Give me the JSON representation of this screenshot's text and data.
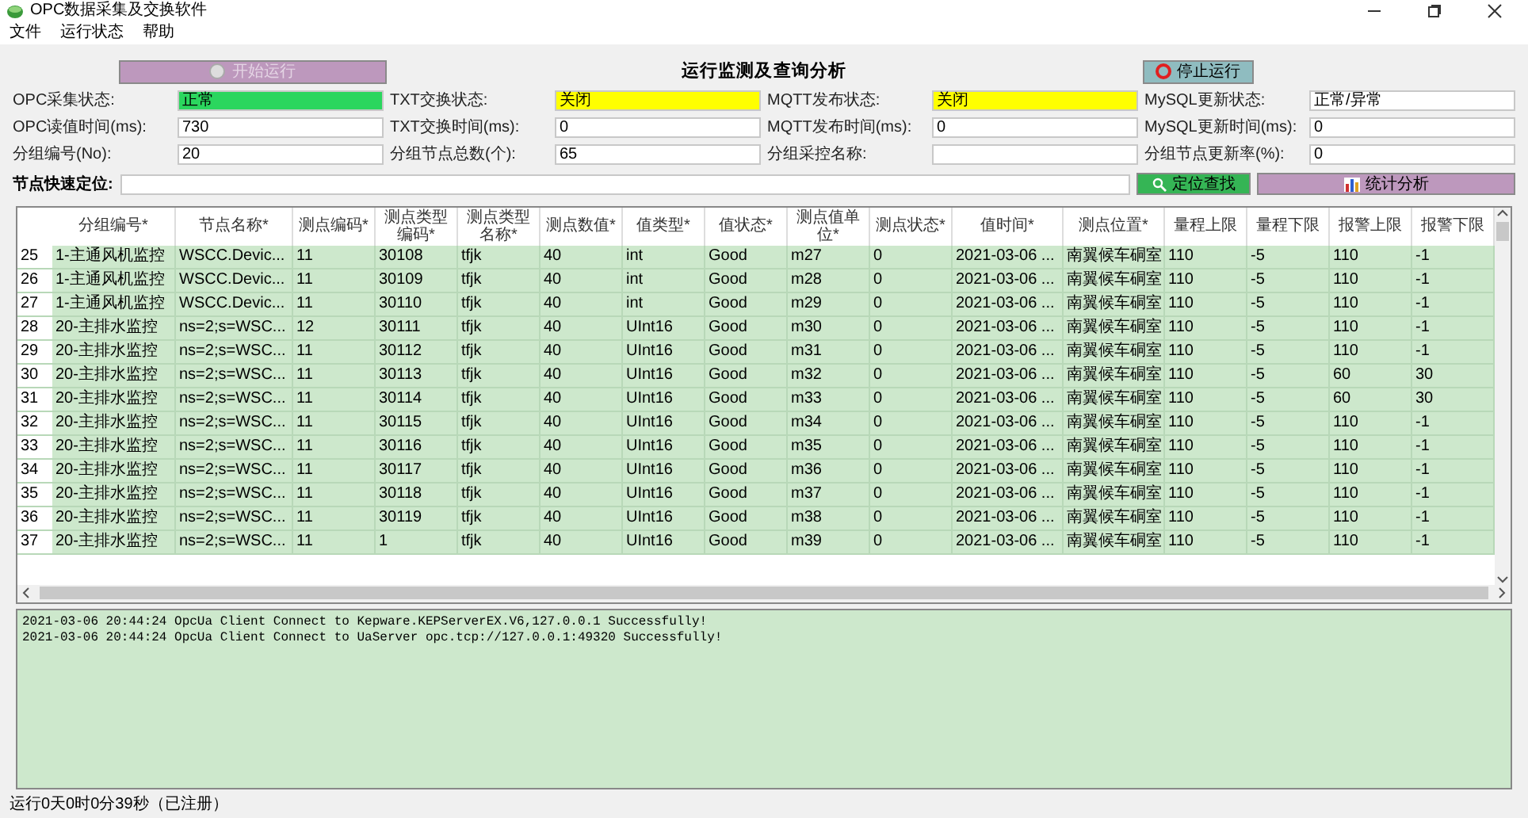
{
  "window": {
    "title": "OPC数据采集及交换软件"
  },
  "menu": [
    "文件",
    "运行状态",
    "帮助"
  ],
  "control_row": {
    "start_button": {
      "label": "开始运行",
      "disabled": true
    },
    "title": "运行监测及查询分析",
    "stop_button": {
      "label": "停止运行",
      "disabled": false
    }
  },
  "form_rows": [
    [
      {
        "label": "OPC采集状态:",
        "value": "正常",
        "color": "#2bd65e"
      },
      {
        "label": "TXT交换状态:",
        "value": "关闭",
        "color": "#ffff00"
      },
      {
        "label": "MQTT发布状态:",
        "value": "关闭",
        "color": "#ffff00"
      },
      {
        "label": "MySQL更新状态:",
        "value": "正常/异常",
        "color": "#ffffff"
      }
    ],
    [
      {
        "label": "OPC读值时间(ms):",
        "value": "730"
      },
      {
        "label": "TXT交换时间(ms):",
        "value": "0"
      },
      {
        "label": "MQTT发布时间(ms):",
        "value": "0"
      },
      {
        "label": "MySQL更新时间(ms):",
        "value": "0"
      }
    ],
    [
      {
        "label": "分组编号(No):",
        "value": "20"
      },
      {
        "label": "分组节点总数(个):",
        "value": "65"
      },
      {
        "label": "分组采控名称:"
      },
      {
        "label": "分组节点更新率(%):",
        "value": "0"
      }
    ]
  ],
  "locate": {
    "label": "节点快速定位:",
    "search_button": "定位查找",
    "stats_button": "统计分析"
  },
  "table": {
    "columns": [
      "分组编号*",
      "节点名称*",
      "测点编码*",
      "测点类型编码*",
      "测点类型名称*",
      "测点数值*",
      "值类型*",
      "值状态*",
      "测点值单位*",
      "测点状态*",
      "值时间*",
      "测点位置*",
      "量程上限",
      "量程下限",
      "报警上限",
      "报警下限"
    ],
    "rows": [
      {
        "index": "25",
        "cells": [
          "1-主通风机监控",
          "WSCC.Devic...",
          "11",
          "30108",
          "tfjk",
          "40",
          "int",
          "Good",
          "m27",
          "0",
          "2021-03-06 ...",
          "南翼候车硐室",
          "110",
          "-5",
          "110",
          "-1"
        ]
      },
      {
        "index": "26",
        "cells": [
          "1-主通风机监控",
          "WSCC.Devic...",
          "11",
          "30109",
          "tfjk",
          "40",
          "int",
          "Good",
          "m28",
          "0",
          "2021-03-06 ...",
          "南翼候车硐室",
          "110",
          "-5",
          "110",
          "-1"
        ]
      },
      {
        "index": "27",
        "cells": [
          "1-主通风机监控",
          "WSCC.Devic...",
          "11",
          "30110",
          "tfjk",
          "40",
          "int",
          "Good",
          "m29",
          "0",
          "2021-03-06 ...",
          "南翼候车硐室",
          "110",
          "-5",
          "110",
          "-1"
        ]
      },
      {
        "index": "28",
        "cells": [
          "20-主排水监控",
          "ns=2;s=WSC...",
          "12",
          "30111",
          "tfjk",
          "40",
          "UInt16",
          "Good",
          "m30",
          "0",
          "2021-03-06 ...",
          "南翼候车硐室",
          "110",
          "-5",
          "110",
          "-1"
        ]
      },
      {
        "index": "29",
        "cells": [
          "20-主排水监控",
          "ns=2;s=WSC...",
          "11",
          "30112",
          "tfjk",
          "40",
          "UInt16",
          "Good",
          "m31",
          "0",
          "2021-03-06 ...",
          "南翼候车硐室",
          "110",
          "-5",
          "110",
          "-1"
        ]
      },
      {
        "index": "30",
        "cells": [
          "20-主排水监控",
          "ns=2;s=WSC...",
          "11",
          "30113",
          "tfjk",
          "40",
          "UInt16",
          "Good",
          "m32",
          "0",
          "2021-03-06 ...",
          "南翼候车硐室",
          "110",
          "-5",
          "60",
          "30"
        ]
      },
      {
        "index": "31",
        "cells": [
          "20-主排水监控",
          "ns=2;s=WSC...",
          "11",
          "30114",
          "tfjk",
          "40",
          "UInt16",
          "Good",
          "m33",
          "0",
          "2021-03-06 ...",
          "南翼候车硐室",
          "110",
          "-5",
          "60",
          "30"
        ]
      },
      {
        "index": "32",
        "cells": [
          "20-主排水监控",
          "ns=2;s=WSC...",
          "11",
          "30115",
          "tfjk",
          "40",
          "UInt16",
          "Good",
          "m34",
          "0",
          "2021-03-06 ...",
          "南翼候车硐室",
          "110",
          "-5",
          "110",
          "-1"
        ]
      },
      {
        "index": "33",
        "cells": [
          "20-主排水监控",
          "ns=2;s=WSC...",
          "11",
          "30116",
          "tfjk",
          "40",
          "UInt16",
          "Good",
          "m35",
          "0",
          "2021-03-06 ...",
          "南翼候车硐室",
          "110",
          "-5",
          "110",
          "-1"
        ]
      },
      {
        "index": "34",
        "cells": [
          "20-主排水监控",
          "ns=2;s=WSC...",
          "11",
          "30117",
          "tfjk",
          "40",
          "UInt16",
          "Good",
          "m36",
          "0",
          "2021-03-06 ...",
          "南翼候车硐室",
          "110",
          "-5",
          "110",
          "-1"
        ]
      },
      {
        "index": "35",
        "cells": [
          "20-主排水监控",
          "ns=2;s=WSC...",
          "11",
          "30118",
          "tfjk",
          "40",
          "UInt16",
          "Good",
          "m37",
          "0",
          "2021-03-06 ...",
          "南翼候车硐室",
          "110",
          "-5",
          "110",
          "-1"
        ]
      },
      {
        "index": "36",
        "cells": [
          "20-主排水监控",
          "ns=2;s=WSC...",
          "11",
          "30119",
          "tfjk",
          "40",
          "UInt16",
          "Good",
          "m38",
          "0",
          "2021-03-06 ...",
          "南翼候车硐室",
          "110",
          "-5",
          "110",
          "-1"
        ]
      },
      {
        "index": "37",
        "cells": [
          "20-主排水监控",
          "ns=2;s=WSC...",
          "11",
          "1",
          "tfjk",
          "40",
          "UInt16",
          "Good",
          "m39",
          "0",
          "2021-03-06 ...",
          "南翼候车硐室",
          "110",
          "-5",
          "110",
          "-1"
        ]
      }
    ]
  },
  "log": [
    "2021-03-06 20:44:24  OpcUa Client Connect to Kepware.KEPServerEX.V6,127.0.0.1 Successfully!",
    "2021-03-06 20:44:24  OpcUa Client Connect to UaServer opc.tcp://127.0.0.1:49320 Successfully!"
  ],
  "status_bar": "运行0天0时0分39秒（已注册）"
}
